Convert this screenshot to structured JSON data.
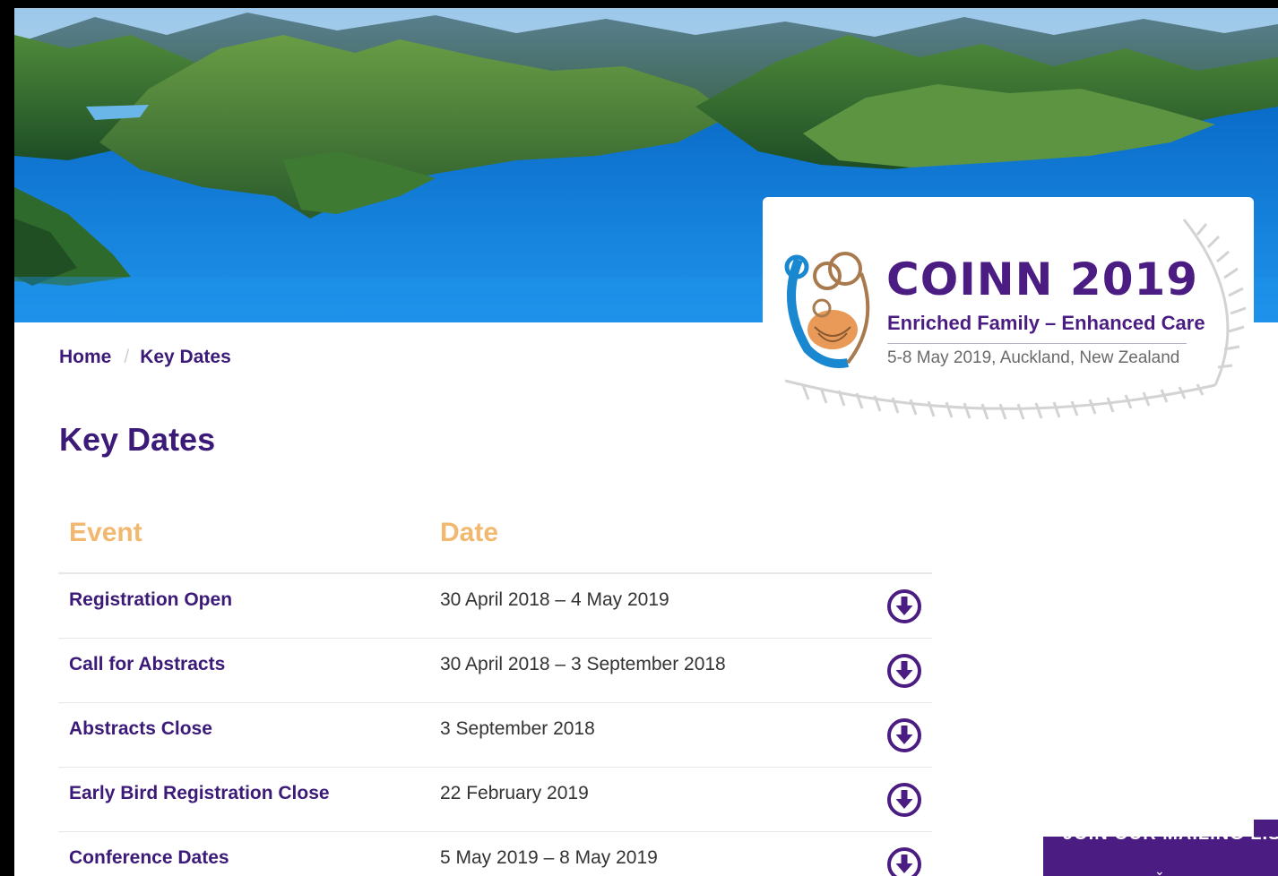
{
  "logo": {
    "title": "COINN 2019",
    "tagline": "Enriched Family – Enhanced Care",
    "info": "5-8 May 2019, Auckland, New Zealand"
  },
  "breadcrumb": {
    "home": "Home",
    "separator": "/",
    "current": "Key Dates"
  },
  "page_title": "Key Dates",
  "table": {
    "headers": {
      "event": "Event",
      "date": "Date"
    },
    "rows": [
      {
        "event": "Registration Open",
        "date": "30 April 2018 – 4 May 2019",
        "icon": "download-circle-icon"
      },
      {
        "event": "Call for Abstracts",
        "date": "30 April 2018 – 3 September 2018",
        "icon": "download-circle-icon"
      },
      {
        "event": "Abstracts Close",
        "date": "3 September 2018",
        "icon": "download-circle-icon"
      },
      {
        "event": "Early Bird Registration Close",
        "date": "22 February 2019",
        "icon": "download-circle-icon"
      },
      {
        "event": "Conference Dates",
        "date": "5 May 2019 – 8 May 2019",
        "icon": "download-circle-icon"
      }
    ]
  },
  "mailing_tab": {
    "label": "JOIN OUR MAILING LIST",
    "icon": "chevron-down-icon"
  },
  "colors": {
    "brand_purple": "#4b1d83",
    "header_orange": "#f3b870",
    "sea_blue": "#1779d8"
  }
}
